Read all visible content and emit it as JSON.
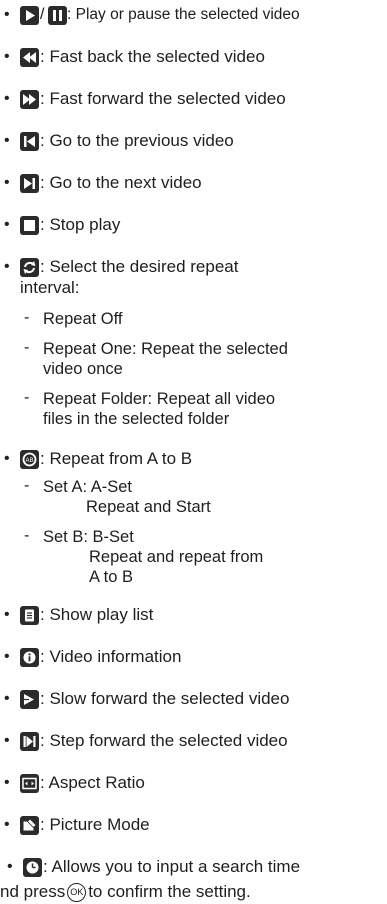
{
  "items": [
    {
      "icon": "play-pause-icon",
      "text": ": Play or pause the selected video"
    },
    {
      "icon": "fast-back-icon",
      "text": ": Fast back the selected video"
    },
    {
      "icon": "fast-forward-icon",
      "text": ": Fast forward the selected video"
    },
    {
      "icon": "previous-video-icon",
      "text": ": Go to the previous video"
    },
    {
      "icon": "next-video-icon",
      "text": ": Go to the next video"
    },
    {
      "icon": "stop-icon",
      "text": ": Stop play"
    },
    {
      "icon": "repeat-icon",
      "text": ": Select the desired repeat",
      "text2": "interval:"
    },
    {
      "icon": "repeat-ab-icon",
      "text": ": Repeat from A to B"
    },
    {
      "icon": "play-list-icon",
      "text": ": Show play list"
    },
    {
      "icon": "info-icon",
      "text": ": Video information"
    },
    {
      "icon": "slow-forward-icon",
      "text": ": Slow forward the selected video"
    },
    {
      "icon": "step-forward-icon",
      "text": ": Step forward the selected video"
    },
    {
      "icon": "aspect-ratio-icon",
      "text": ": Aspect Ratio"
    },
    {
      "icon": "picture-mode-icon",
      "text": ": Picture Mode"
    },
    {
      "icon": "search-time-icon",
      "text": ": Allows you to input a search time"
    }
  ],
  "repeat_options": [
    {
      "lines": [
        "Repeat Off"
      ]
    },
    {
      "lines": [
        "Repeat One: Repeat the selected",
        "video once"
      ]
    },
    {
      "lines": [
        "Repeat Folder: Repeat all video",
        "files in the selected folder"
      ]
    }
  ],
  "ab_options": [
    {
      "lines": [
        "Set A: A-Set",
        "Repeat and Start"
      ]
    },
    {
      "lines": [
        "Set B: B-Set",
        "Repeat and repeat from",
        "A to B"
      ]
    }
  ],
  "footer": {
    "before": "nd press ",
    "ok_label": "OK",
    "after": " to confirm the setting."
  },
  "bullet": "•",
  "dash": "-"
}
